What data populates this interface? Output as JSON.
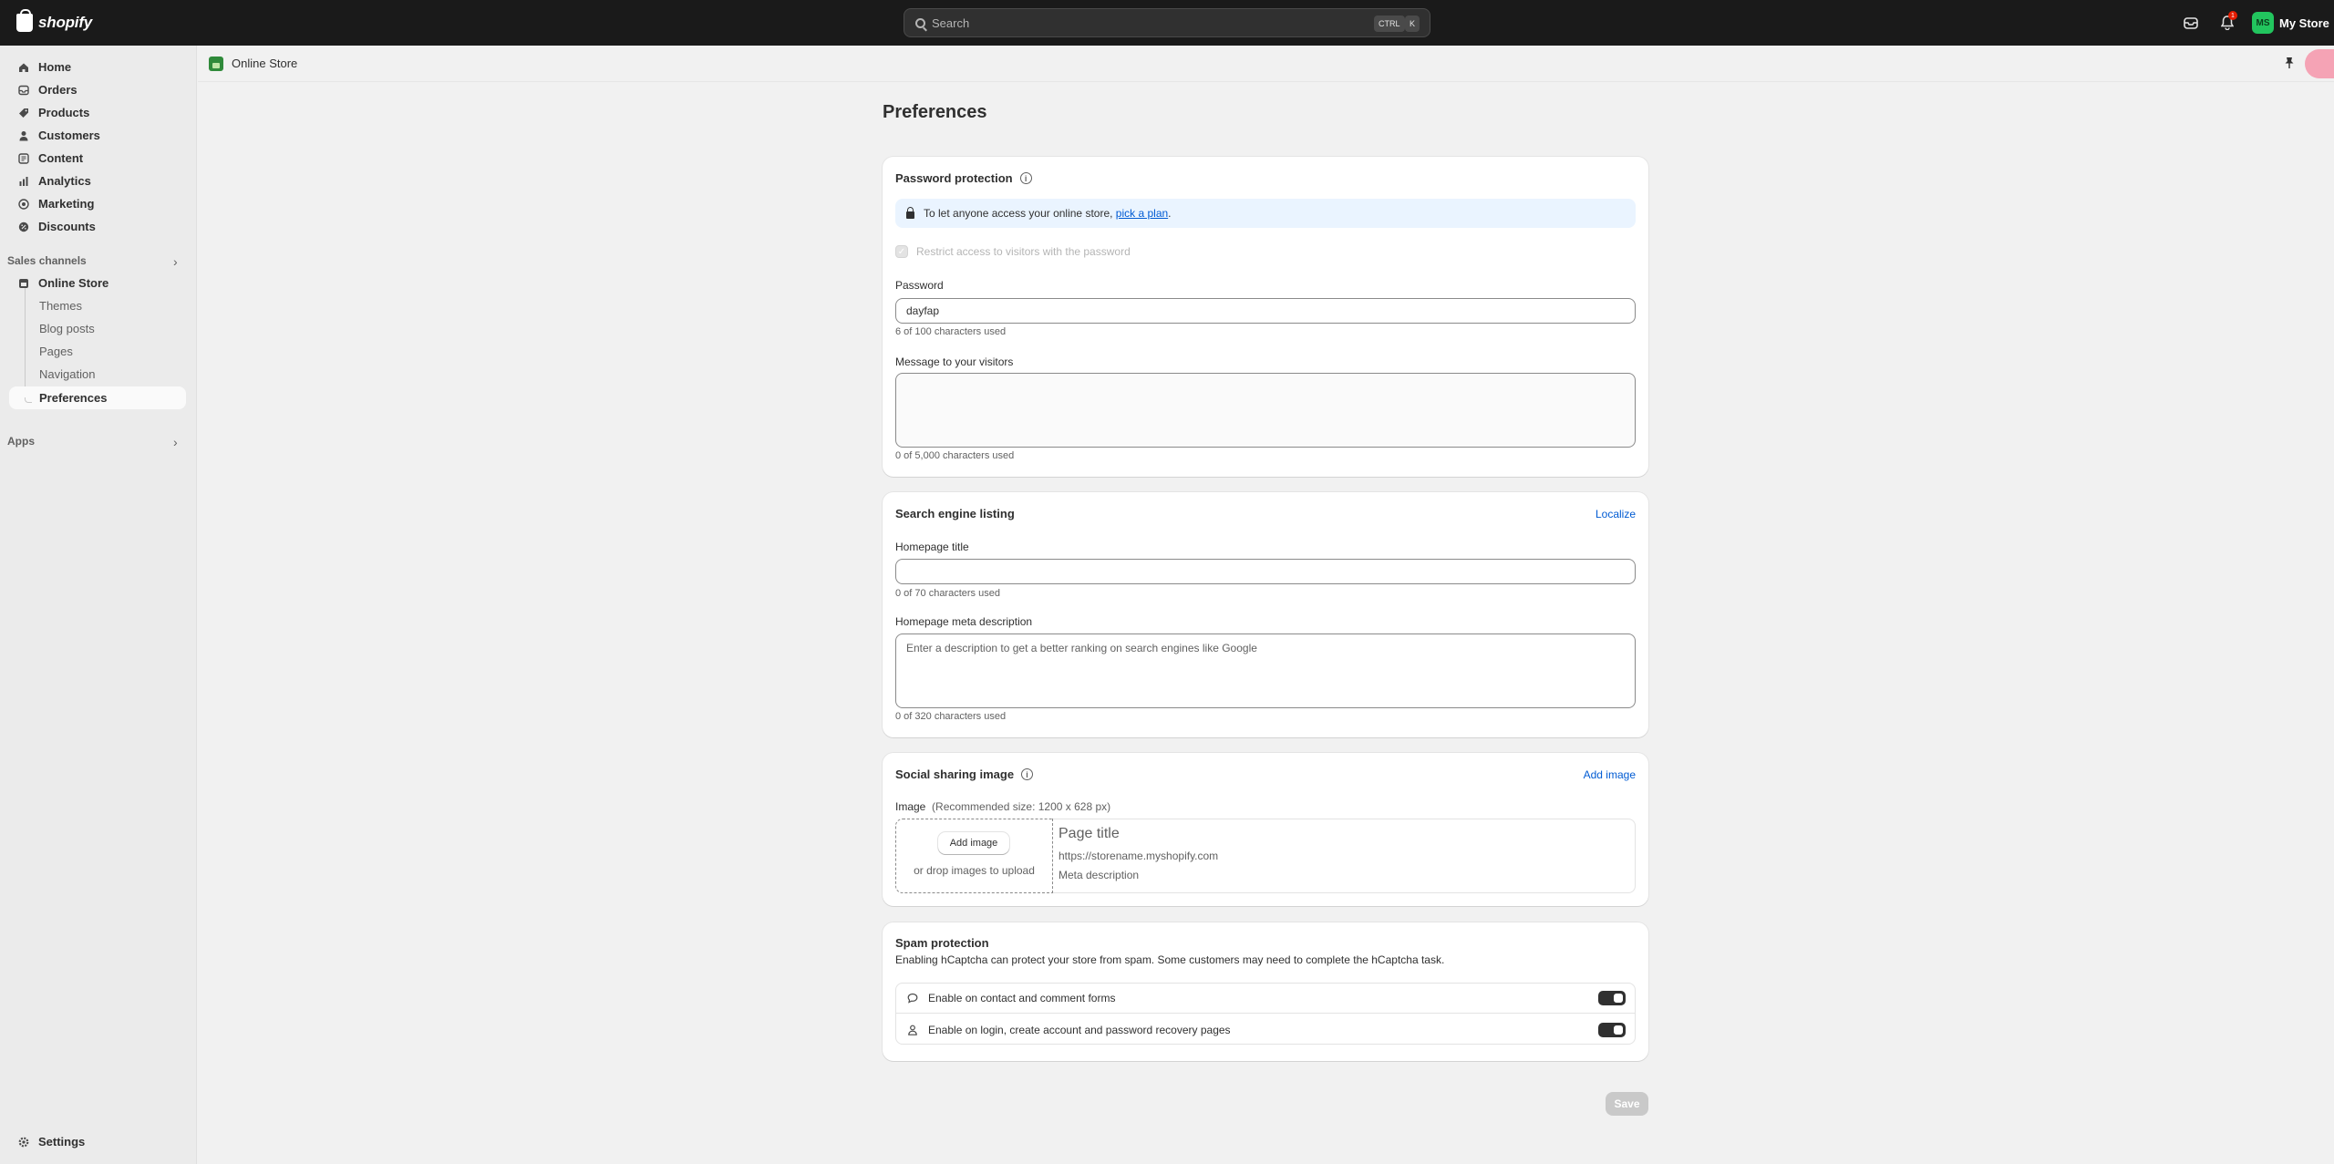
{
  "topbar": {
    "brand": "shopify",
    "search_placeholder": "Search",
    "shortcut_ctrl": "CTRL",
    "shortcut_key": "K",
    "notification_count": "1",
    "store_initials": "MS",
    "store_name": "My Store"
  },
  "sidebar": {
    "main_items": [
      {
        "label": "Home",
        "icon": "home-icon"
      },
      {
        "label": "Orders",
        "icon": "inbox-icon"
      },
      {
        "label": "Products",
        "icon": "tag-icon"
      },
      {
        "label": "Customers",
        "icon": "person-icon"
      },
      {
        "label": "Content",
        "icon": "content-icon"
      },
      {
        "label": "Analytics",
        "icon": "chart-icon"
      },
      {
        "label": "Marketing",
        "icon": "target-icon"
      },
      {
        "label": "Discounts",
        "icon": "discount-icon"
      }
    ],
    "sales_channels_label": "Sales channels",
    "online_store_label": "Online Store",
    "sub_items": [
      "Themes",
      "Blog posts",
      "Pages",
      "Navigation",
      "Preferences"
    ],
    "apps_label": "Apps",
    "settings_label": "Settings"
  },
  "breadcrumb": {
    "label": "Online Store"
  },
  "page": {
    "title": "Preferences"
  },
  "password_protection": {
    "title": "Password protection",
    "banner_text": "To let anyone access your online store, ",
    "banner_link": "pick a plan",
    "banner_end": ".",
    "restrict_label": "Restrict access to visitors with the password",
    "restrict_checked": true,
    "password_label": "Password",
    "password_value": "dayfap",
    "password_hint": "6 of 100 characters used",
    "message_label": "Message to your visitors",
    "message_value": "",
    "message_hint": "0 of 5,000 characters used"
  },
  "search_listing": {
    "title": "Search engine listing",
    "localize_link": "Localize",
    "homepage_title_label": "Homepage title",
    "homepage_title_value": "",
    "homepage_title_hint": "0 of 70 characters used",
    "meta_label": "Homepage meta description",
    "meta_placeholder": "Enter a description to get a better ranking on search engines like Google",
    "meta_hint": "0 of 320 characters used"
  },
  "social_image": {
    "title": "Social sharing image",
    "add_image_link": "Add image",
    "image_label": "Image",
    "image_recommendation": "(Recommended size: 1200 x 628 px)",
    "add_image_button": "Add image",
    "drop_text": "or drop images to upload",
    "preview_title": "Page title",
    "preview_url": "https://storename.myshopify.com",
    "preview_description": "Meta description"
  },
  "spam_protection": {
    "title": "Spam protection",
    "description": "Enabling hCaptcha can protect your store from spam. Some customers may need to complete the hCaptcha task.",
    "options": [
      {
        "label": "Enable on contact and comment forms",
        "enabled": true
      },
      {
        "label": "Enable on login, create account and password recovery pages",
        "enabled": true
      }
    ]
  },
  "actions": {
    "save_label": "Save"
  },
  "colors": {
    "topbar": "#1a1a1a",
    "link": "#005bd3",
    "banner": "#eaf4ff",
    "avatar": "#22c55e"
  }
}
